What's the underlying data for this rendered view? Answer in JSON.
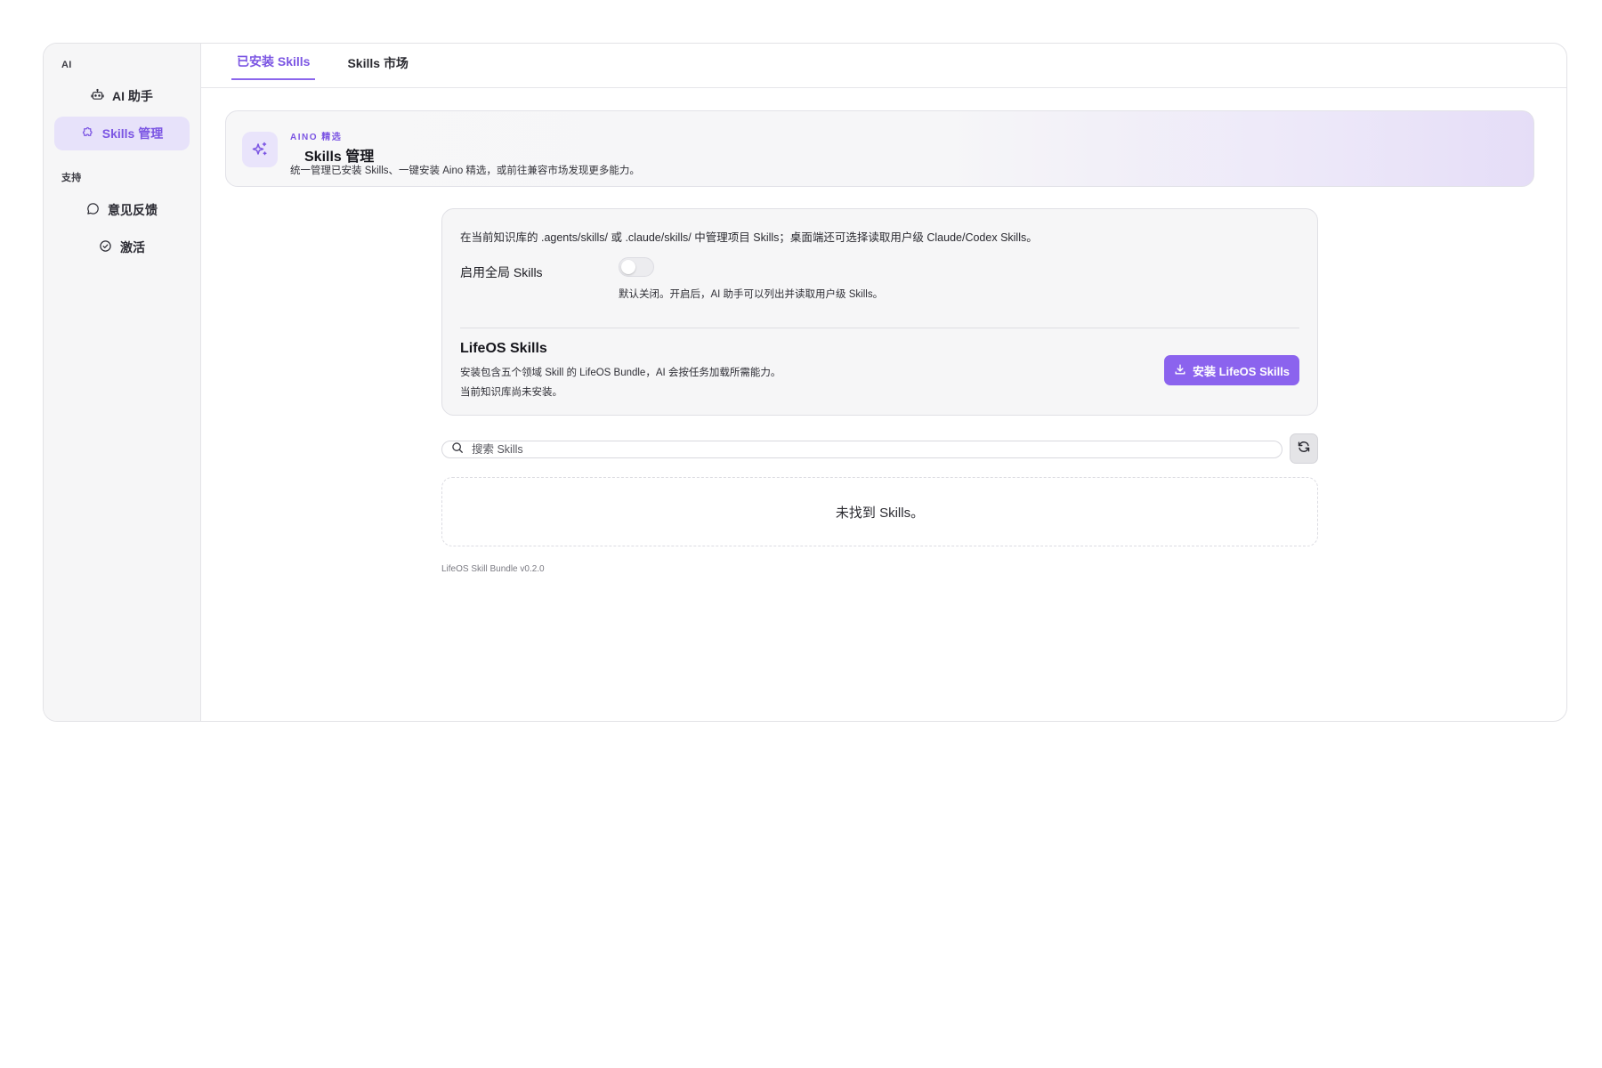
{
  "sidebar": {
    "section_ai": "AI",
    "section_support": "支持",
    "items": [
      {
        "label": "AI 助手",
        "icon": "robot-icon"
      },
      {
        "label": "Skills 管理",
        "icon": "puzzle-icon",
        "active": true
      },
      {
        "label": "意见反馈",
        "icon": "message-icon"
      },
      {
        "label": "激活",
        "icon": "check-circle-icon"
      }
    ]
  },
  "tabs": [
    {
      "label": "已安装 Skills",
      "active": true
    },
    {
      "label": "Skills 市场",
      "active": false
    }
  ],
  "hero": {
    "tag": "AINO 精选",
    "title": "Skills 管理",
    "description": "统一管理已安装 Skills、一键安装 Aino 精选，或前往兼容市场发现更多能力。",
    "icon": "sparkles-icon"
  },
  "panel": {
    "intro": "在当前知识库的 .agents/skills/ 或 .claude/skills/ 中管理项目 Skills；桌面端还可选择读取用户级 Claude/Codex Skills。",
    "global_label": "启用全局 Skills",
    "global_enabled": false,
    "global_hint": "默认关闭。开启后，AI 助手可以列出并读取用户级 Skills。",
    "lifeos_title": "LifeOS Skills",
    "lifeos_description": "安装包含五个领域 Skill 的 LifeOS Bundle，AI 会按任务加载所需能力。",
    "lifeos_status": "当前知识库尚未安装。",
    "install_button": "安装 LifeOS Skills"
  },
  "search": {
    "placeholder": "搜索 Skills",
    "value": ""
  },
  "empty_state": "未找到 Skills。",
  "version": "LifeOS Skill Bundle v0.2.0",
  "colors": {
    "accent": "#8b63ee",
    "accent_text": "#7b55e3",
    "sidebar_bg": "#f6f6f7",
    "active_bg": "#e7e2fa"
  }
}
